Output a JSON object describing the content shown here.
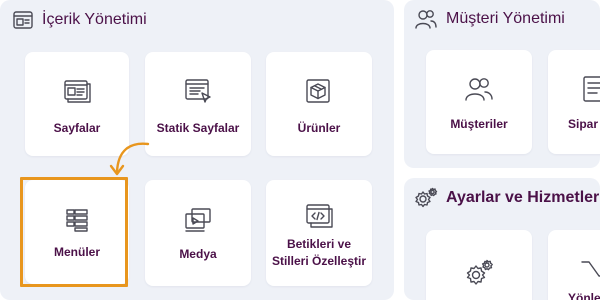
{
  "content_panel": {
    "title": "İçerik Yönetimi",
    "cards": [
      {
        "label": "Sayfalar",
        "icon": "pages-icon"
      },
      {
        "label": "Statik Sayfalar",
        "icon": "static-pages-icon"
      },
      {
        "label": "Ürünler",
        "icon": "products-icon"
      },
      {
        "label": "Menüler",
        "icon": "menus-icon",
        "highlighted": true
      },
      {
        "label": "Medya",
        "icon": "media-icon"
      },
      {
        "label": "Betikleri ve Stilleri Özelleştir",
        "icon": "code-icon"
      }
    ]
  },
  "customer_panel": {
    "title": "Müşteri Yönetimi",
    "cards": [
      {
        "label": "Müşteriler",
        "icon": "customers-icon"
      },
      {
        "label": "Sipar",
        "icon": "orders-icon"
      }
    ]
  },
  "settings_panel": {
    "title": "Ayarlar ve Hizmetler",
    "cards": [
      {
        "label": "",
        "icon": "settings-gear-icon"
      },
      {
        "label": "Yönler",
        "icon": "redirect-icon"
      }
    ]
  },
  "colors": {
    "panel_bg": "#eef1f7",
    "title_text": "#4b1148",
    "highlight": "#e8961e",
    "icon_stroke": "#4a4a55"
  }
}
